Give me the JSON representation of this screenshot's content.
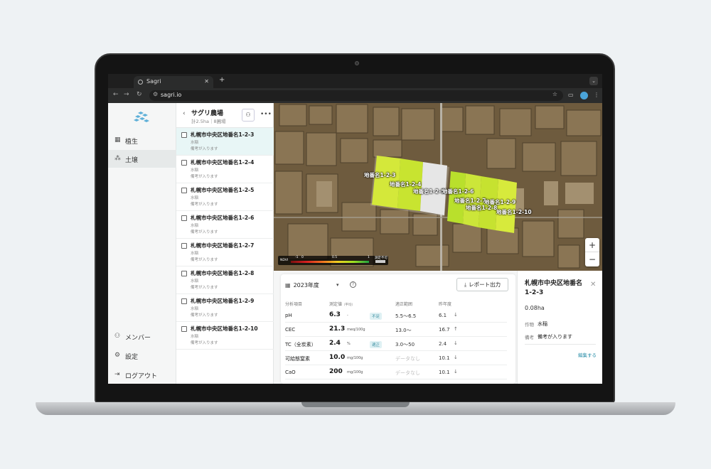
{
  "browser": {
    "tab_title": "Sagri",
    "tab_close": "✕",
    "new_tab": "+",
    "url": "sagri.io"
  },
  "sidebar": {
    "items": [
      {
        "icon": "grid-icon",
        "label": "植生"
      },
      {
        "icon": "soil-icon",
        "label": "土壌"
      }
    ],
    "bottom": [
      {
        "icon": "members-icon",
        "label": "メンバー"
      },
      {
        "icon": "gear-icon",
        "label": "設定"
      },
      {
        "icon": "logout-icon",
        "label": "ログアウト"
      }
    ]
  },
  "field_list": {
    "farm_name": "サグリ農場",
    "farm_summary": "計2.5ha｜8圃場",
    "fields": [
      {
        "name": "札幌市中央区地番名1-2-3",
        "crop": "水稲",
        "note": "備考が入ります"
      },
      {
        "name": "札幌市中央区地番名1-2-4",
        "crop": "水稲",
        "note": "備考が入ります"
      },
      {
        "name": "札幌市中央区地番名1-2-5",
        "crop": "水稲",
        "note": "備考が入ります"
      },
      {
        "name": "札幌市中央区地番名1-2-6",
        "crop": "水稲",
        "note": "備考が入ります"
      },
      {
        "name": "札幌市中央区地番名1-2-7",
        "crop": "水稲",
        "note": "備考が入ります"
      },
      {
        "name": "札幌市中央区地番名1-2-8",
        "crop": "水稲",
        "note": "備考が入ります"
      },
      {
        "name": "札幌市中央区地番名1-2-9",
        "crop": "水稲",
        "note": "備考が入ります"
      },
      {
        "name": "札幌市中央区地番名1-2-10",
        "crop": "水稲",
        "note": "備考が入ります"
      }
    ]
  },
  "map": {
    "labels": [
      "地番名1-2-3",
      "地番名1-2-4",
      "地番名1-2-5",
      "地番名1-2-6",
      "地番名1-2-7",
      "地番名1-2-9",
      "地番名1-2-8",
      "地番名1-2-10"
    ],
    "zoom_in": "+",
    "zoom_out": "−",
    "legend": {
      "name": "NDVI",
      "min": "-1",
      "mid_left": "0",
      "mid": "0.5",
      "max": "1",
      "no_data": "測定不可"
    }
  },
  "soil_panel": {
    "year": "2023年度",
    "report_button": "レポート出力",
    "headers": {
      "item": "分析項目",
      "value": "測定値",
      "value_note": "（平均）",
      "range": "適正範囲",
      "last_year": "昨年度"
    },
    "rows": [
      {
        "item": "pH",
        "value": "6.3",
        "unit": "-",
        "badge": "不足",
        "range": "5.5〜6.5",
        "last": "6.1",
        "trend": "↓"
      },
      {
        "item": "CEC",
        "value": "21.3",
        "unit": "meq/100g",
        "badge": "",
        "range": "13.0〜",
        "last": "16.7",
        "trend": "↑"
      },
      {
        "item": "TC（全炭素）",
        "value": "2.4",
        "unit": "%",
        "badge": "適正",
        "range": "3.0〜50",
        "last": "2.4",
        "trend": "↓"
      },
      {
        "item": "可給態窒素",
        "value": "10.0",
        "unit": "mg/100g",
        "badge": "",
        "range": "データなし",
        "last": "10.1",
        "trend": "↓"
      },
      {
        "item": "CaO",
        "value": "200",
        "unit": "mg/100g",
        "badge": "",
        "range": "データなし",
        "last": "10.1",
        "trend": "↓"
      }
    ]
  },
  "detail": {
    "title": "札幌市中央区地番名1-2-3",
    "area": "0.08ha",
    "crop_label": "作物",
    "crop": "水稲",
    "note_label": "備考",
    "note": "備考が入ります",
    "edit": "編集する"
  }
}
